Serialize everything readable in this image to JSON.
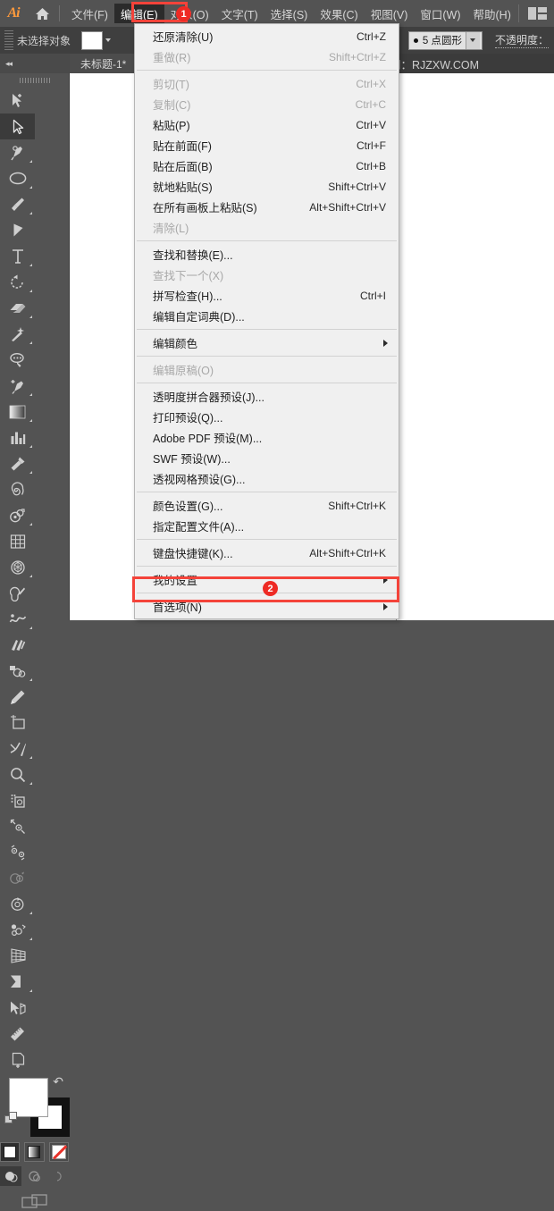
{
  "app": {
    "logo": "Ai",
    "home_icon": "home-icon",
    "arrange_icon": "arrange-documents-icon"
  },
  "menubar": {
    "items": [
      {
        "label": "文件(F)",
        "active": false
      },
      {
        "label": "编辑(E)",
        "active": true
      },
      {
        "label": "对象(O)",
        "active": false
      },
      {
        "label": "文字(T)",
        "active": false
      },
      {
        "label": "选择(S)",
        "active": false
      },
      {
        "label": "效果(C)",
        "active": false
      },
      {
        "label": "视图(V)",
        "active": false
      },
      {
        "label": "窗口(W)",
        "active": false
      },
      {
        "label": "帮助(H)",
        "active": false
      }
    ]
  },
  "controlbar": {
    "selection_label": "未选择对象",
    "fill_swatch": "white-fill-swatch",
    "stroke_profile": "5 点圆形",
    "opacity_label": "不透明度："
  },
  "tabbar": {
    "collapse_icon": "collapse-panel-icon",
    "document_tab": "未标题-1*"
  },
  "canvas": {
    "watermark": "软件自学网：RJZXW.COM"
  },
  "toolpanel": {
    "tools": [
      {
        "name": "selection-tool",
        "selected": false
      },
      {
        "name": "direct-selection-tool",
        "selected": true
      },
      {
        "name": "pen-tool",
        "selected": false
      },
      {
        "name": "ellipse-tool",
        "selected": false
      },
      {
        "name": "paintbrush-tool",
        "selected": false
      },
      {
        "name": "shape-builder-tool",
        "selected": false
      },
      {
        "name": "type-tool",
        "selected": false
      },
      {
        "name": "rotate-tool",
        "selected": false
      },
      {
        "name": "eraser-tool",
        "selected": false
      },
      {
        "name": "magic-wand-tool",
        "selected": false
      },
      {
        "name": "lasso-tool",
        "selected": false
      },
      {
        "name": "add-anchor-point-tool",
        "selected": false
      },
      {
        "name": "gradient-tool",
        "selected": false
      },
      {
        "name": "column-graph-tool",
        "selected": false
      },
      {
        "name": "eyedropper-tool",
        "selected": false
      },
      {
        "name": "spiral-tool",
        "selected": false
      },
      {
        "name": "blend-tool",
        "selected": false
      },
      {
        "name": "mesh-tool",
        "selected": false
      },
      {
        "name": "live-paint-bucket-tool",
        "selected": false
      },
      {
        "name": "blob-brush-tool",
        "selected": false
      },
      {
        "name": "warp-tool",
        "selected": false
      },
      {
        "name": "width-tool",
        "selected": false
      },
      {
        "name": "shape-tool",
        "selected": false
      },
      {
        "name": "pencil-tool",
        "selected": false
      },
      {
        "name": "artboard-tool",
        "selected": false
      },
      {
        "name": "slice-tool",
        "selected": false
      },
      {
        "name": "zoom-tool",
        "selected": false
      },
      {
        "name": "print-tiling-tool",
        "selected": false
      },
      {
        "name": "scale-tool",
        "selected": false
      },
      {
        "name": "free-transform-tool",
        "selected": false
      },
      {
        "name": "reshape-tool",
        "selected": false
      },
      {
        "name": "rotate-view-tool",
        "selected": false
      },
      {
        "name": "symbol-sprayer-tool",
        "selected": false
      },
      {
        "name": "perspective-grid-tool",
        "selected": false
      },
      {
        "name": "knife-tool",
        "selected": false
      },
      {
        "name": "perspective-selection-tool",
        "selected": false
      },
      {
        "name": "measure-tool",
        "selected": false
      },
      {
        "name": "new-artboard-tool",
        "selected": false
      }
    ],
    "fill_color": "#ffffff",
    "stroke_color": "#121212",
    "color_modes": [
      {
        "name": "color-mode-solid",
        "active": true
      },
      {
        "name": "color-mode-gradient",
        "active": false
      },
      {
        "name": "color-mode-none",
        "active": false
      }
    ],
    "draw_modes": [
      {
        "name": "draw-normal-mode",
        "active": true
      },
      {
        "name": "draw-behind-mode",
        "active": false
      },
      {
        "name": "draw-inside-mode",
        "active": false
      }
    ],
    "screen_mode": "change-screen-mode-icon"
  },
  "dropdown": {
    "groups": [
      {
        "rows": [
          {
            "label": "还原清除(U)",
            "key": "Ctrl+Z",
            "disabled": false,
            "submenu": false
          },
          {
            "label": "重做(R)",
            "key": "Shift+Ctrl+Z",
            "disabled": true,
            "submenu": false
          }
        ]
      },
      {
        "rows": [
          {
            "label": "剪切(T)",
            "key": "Ctrl+X",
            "disabled": true,
            "submenu": false
          },
          {
            "label": "复制(C)",
            "key": "Ctrl+C",
            "disabled": true,
            "submenu": false
          },
          {
            "label": "粘贴(P)",
            "key": "Ctrl+V",
            "disabled": false,
            "submenu": false
          },
          {
            "label": "贴在前面(F)",
            "key": "Ctrl+F",
            "disabled": false,
            "submenu": false
          },
          {
            "label": "贴在后面(B)",
            "key": "Ctrl+B",
            "disabled": false,
            "submenu": false
          },
          {
            "label": "就地粘贴(S)",
            "key": "Shift+Ctrl+V",
            "disabled": false,
            "submenu": false
          },
          {
            "label": "在所有画板上粘贴(S)",
            "key": "Alt+Shift+Ctrl+V",
            "disabled": false,
            "submenu": false
          },
          {
            "label": "清除(L)",
            "key": "",
            "disabled": true,
            "submenu": false
          }
        ]
      },
      {
        "rows": [
          {
            "label": "查找和替换(E)...",
            "key": "",
            "disabled": false,
            "submenu": false
          },
          {
            "label": "查找下一个(X)",
            "key": "",
            "disabled": true,
            "submenu": false
          },
          {
            "label": "拼写检查(H)...",
            "key": "Ctrl+I",
            "disabled": false,
            "submenu": false
          },
          {
            "label": "编辑自定词典(D)...",
            "key": "",
            "disabled": false,
            "submenu": false
          }
        ]
      },
      {
        "rows": [
          {
            "label": "编辑颜色",
            "key": "",
            "disabled": false,
            "submenu": true
          }
        ]
      },
      {
        "rows": [
          {
            "label": "编辑原稿(O)",
            "key": "",
            "disabled": true,
            "submenu": false
          }
        ]
      },
      {
        "rows": [
          {
            "label": "透明度拼合器预设(J)...",
            "key": "",
            "disabled": false,
            "submenu": false
          },
          {
            "label": "打印预设(Q)...",
            "key": "",
            "disabled": false,
            "submenu": false
          },
          {
            "label": "Adobe PDF 预设(M)...",
            "key": "",
            "disabled": false,
            "submenu": false
          },
          {
            "label": "SWF 预设(W)...",
            "key": "",
            "disabled": false,
            "submenu": false
          },
          {
            "label": "透视网格预设(G)...",
            "key": "",
            "disabled": false,
            "submenu": false
          }
        ]
      },
      {
        "rows": [
          {
            "label": "颜色设置(G)...",
            "key": "Shift+Ctrl+K",
            "disabled": false,
            "submenu": false
          },
          {
            "label": "指定配置文件(A)...",
            "key": "",
            "disabled": false,
            "submenu": false
          }
        ]
      },
      {
        "rows": [
          {
            "label": "键盘快捷键(K)...",
            "key": "Alt+Shift+Ctrl+K",
            "disabled": false,
            "submenu": false
          }
        ]
      },
      {
        "rows": [
          {
            "label": "我的设置",
            "key": "",
            "disabled": false,
            "submenu": true
          }
        ]
      },
      {
        "rows": [
          {
            "label": "首选项(N)",
            "key": "",
            "disabled": false,
            "submenu": true,
            "highlighted": true
          }
        ]
      }
    ]
  },
  "annotations": {
    "badges": [
      {
        "number": "1",
        "target": "edit-menu"
      },
      {
        "number": "2",
        "target": "preferences-menu-item"
      }
    ],
    "color": "#ee2a24",
    "box_color": "#f4433a"
  }
}
